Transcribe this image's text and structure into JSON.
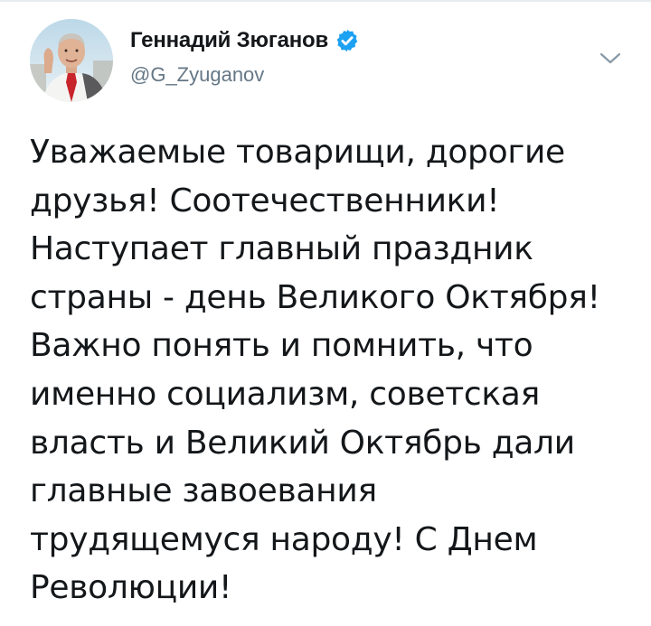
{
  "tweet": {
    "author": {
      "display_name": "Геннадий Зюганов",
      "handle": "@G_Zyuganov",
      "verified": true,
      "avatar_icon": "avatar-photo"
    },
    "menu_icon": "chevron-down-icon",
    "text_lines": [
      "Уважаемые товарищи, дорогие",
      "друзья! Соотечественники!",
      "Наступает главный праздник",
      "страны - день Великого Октября!",
      "Важно понять и помнить, что",
      "именно социализм, советская",
      "власть и Великий Октябрь дали",
      "главные завоевания",
      "трудящемуся народу! С Днем",
      "Революции!"
    ]
  },
  "colors": {
    "primary_text": "#14171a",
    "secondary_text": "#657786",
    "verified_badge": "#1da1f2",
    "divider": "#e6ecf0"
  }
}
